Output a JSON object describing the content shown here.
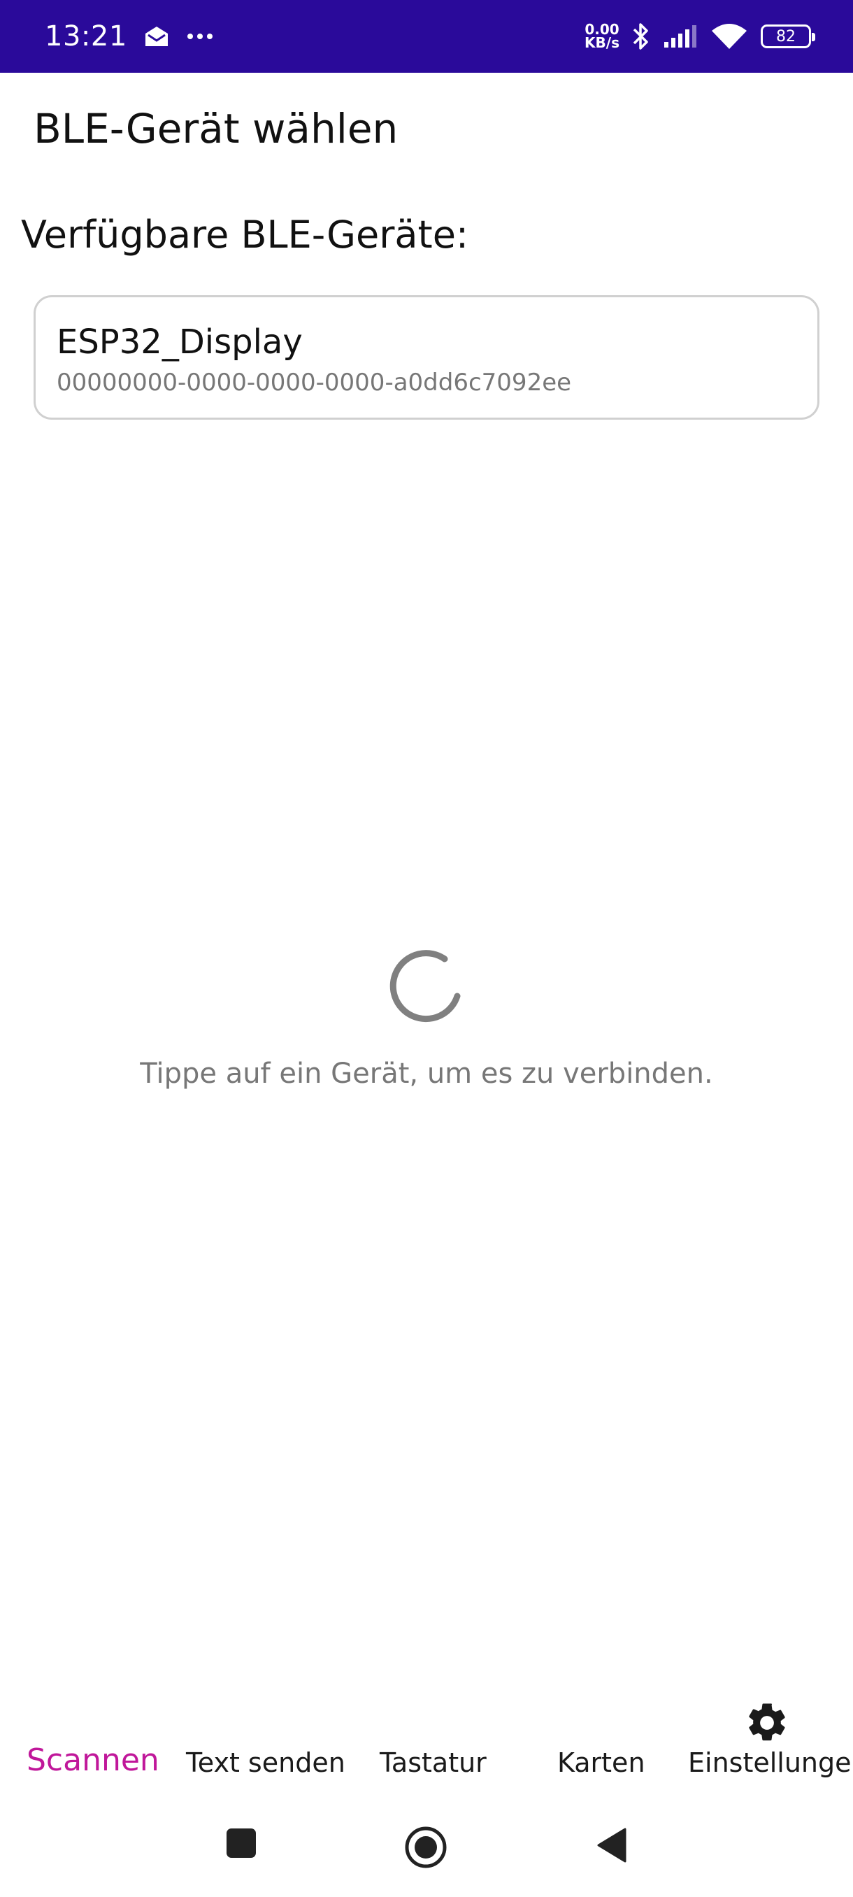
{
  "status_bar": {
    "time": "13:21",
    "net_speed_value": "0.00",
    "net_speed_unit": "KB/s",
    "battery": "82",
    "background": "#2a0a9a"
  },
  "app_bar": {
    "title": "BLE-Gerät wählen"
  },
  "main": {
    "section_heading": "Verfügbare BLE-Geräte:",
    "devices": [
      {
        "name": "ESP32_Display",
        "id": "00000000-0000-0000-0000-a0dd6c7092ee"
      }
    ],
    "hint": "Tippe auf ein Gerät, um es zu verbinden."
  },
  "bottom_nav": {
    "active_color": "#c0179a",
    "items": [
      {
        "label": "Scannen",
        "active": true
      },
      {
        "label": "Text senden",
        "active": false
      },
      {
        "label": "Tastatur",
        "active": false
      },
      {
        "label": "Karten",
        "active": false
      },
      {
        "label": "Einstellungen",
        "active": false,
        "icon": "gear-icon"
      }
    ]
  },
  "system_nav": {
    "buttons": [
      "recents-icon",
      "home-icon",
      "back-icon"
    ]
  }
}
